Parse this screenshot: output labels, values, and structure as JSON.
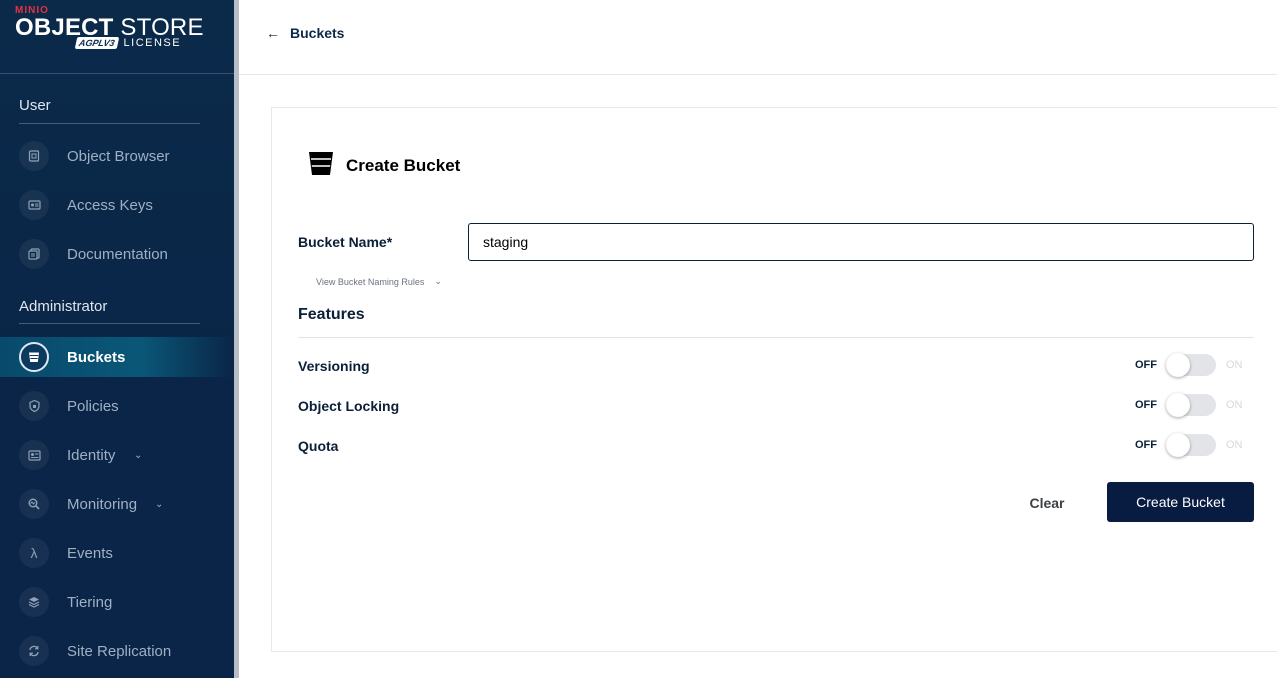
{
  "logo": {
    "brand": "MINIO",
    "product_bold": "OBJECT",
    "product_rest": " STORE",
    "badge": "AGPLV3",
    "license": "LICENSE"
  },
  "sidebar": {
    "user_section": "User",
    "user_items": [
      {
        "label": "Object Browser",
        "icon": "object-browser-icon"
      },
      {
        "label": "Access Keys",
        "icon": "access-keys-icon"
      },
      {
        "label": "Documentation",
        "icon": "documentation-icon"
      }
    ],
    "admin_section": "Administrator",
    "admin_items": [
      {
        "label": "Buckets",
        "icon": "bucket-icon",
        "active": true
      },
      {
        "label": "Policies",
        "icon": "shield-icon"
      },
      {
        "label": "Identity",
        "icon": "identity-icon",
        "expandable": true
      },
      {
        "label": "Monitoring",
        "icon": "monitoring-icon",
        "expandable": true
      },
      {
        "label": "Events",
        "icon": "lambda-icon"
      },
      {
        "label": "Tiering",
        "icon": "layers-icon"
      },
      {
        "label": "Site Replication",
        "icon": "replication-icon"
      }
    ]
  },
  "topbar": {
    "back_label": "Buckets"
  },
  "panel": {
    "title": "Create Bucket",
    "bucket_name_label": "Bucket Name*",
    "bucket_name_value": "staging",
    "naming_rules": "View Bucket Naming Rules",
    "features_title": "Features",
    "features": [
      {
        "label": "Versioning",
        "off": "OFF",
        "on": "ON",
        "enabled": false
      },
      {
        "label": "Object Locking",
        "off": "OFF",
        "on": "ON",
        "enabled": false
      },
      {
        "label": "Quota",
        "off": "OFF",
        "on": "ON",
        "enabled": false
      }
    ],
    "clear_label": "Clear",
    "create_label": "Create Bucket"
  },
  "colors": {
    "sidebar_bg": "#0b2a4a",
    "primary_button": "#081c42",
    "brand_red": "#e3313f"
  }
}
